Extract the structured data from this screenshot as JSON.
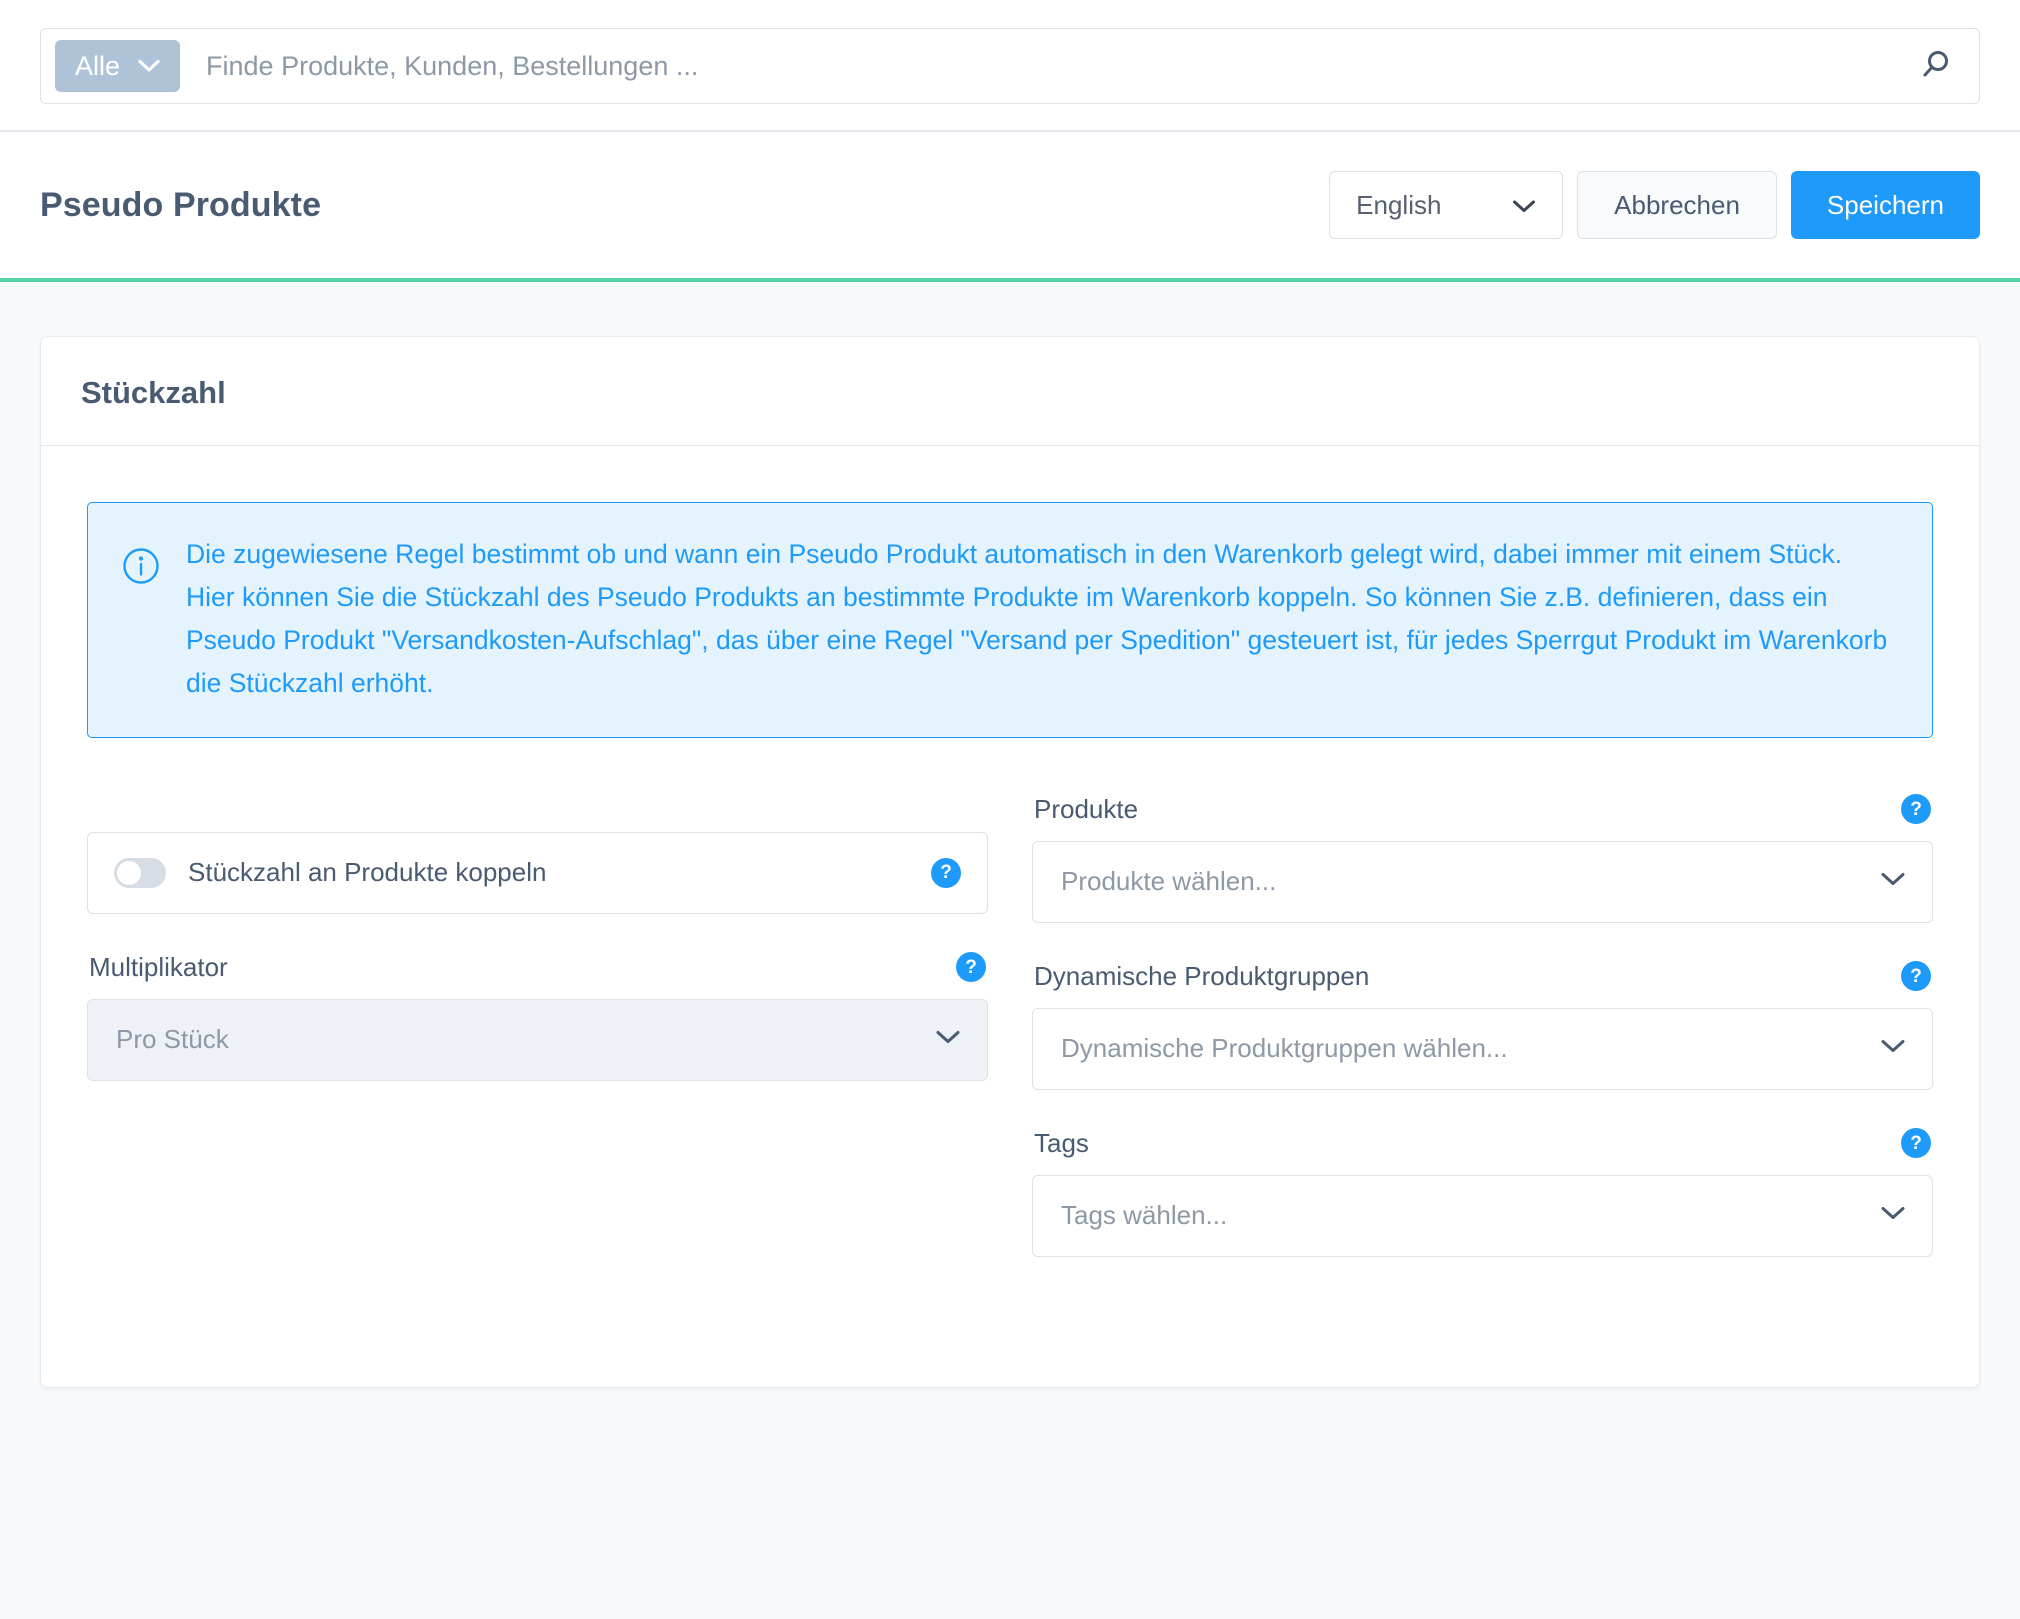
{
  "search": {
    "scope_label": "Alle",
    "placeholder": "Finde Produkte, Kunden, Bestellungen ...",
    "value": "",
    "icon": "search-icon"
  },
  "header": {
    "title": "Pseudo Produkte",
    "language_value": "English",
    "cancel_label": "Abbrechen",
    "save_label": "Speichern",
    "accent_color": "#51d3a5",
    "primary_color": "#1e9bfa"
  },
  "card": {
    "title": "Stückzahl",
    "alert": {
      "icon": "info-circle-icon",
      "text": "Die zugewiesene Regel bestimmt ob und wann ein Pseudo Produkt automatisch in den Warenkorb gelegt wird, dabei immer mit einem Stück. Hier können Sie die Stückzahl des Pseudo Produkts an bestimmte Produkte im Warenkorb koppeln. So können Sie z.B. definieren, dass ein Pseudo Produkt \"Versandkosten-Aufschlag\", das über eine Regel \"Versand per Spedition\" gesteuert ist, für jedes Sperrgut Produkt im Warenkorb die Stückzahl erhöht.",
      "border_color": "#1e9bfa",
      "background_color": "#e4f3fe"
    },
    "coupling_toggle": {
      "label": "Stückzahl an Produkte koppeln",
      "state": "off",
      "help_icon": "help-circle-icon"
    },
    "multiplikator": {
      "label": "Multiplikator",
      "value": "Pro Stück",
      "disabled": true,
      "help_icon": "help-circle-icon",
      "chevron": "chevron-down-icon"
    },
    "produkte": {
      "label": "Produkte",
      "placeholder": "Produkte wählen...",
      "value": "",
      "help_icon": "help-circle-icon",
      "chevron": "chevron-down-icon"
    },
    "dynamische_produktgruppen": {
      "label": "Dynamische Produktgruppen",
      "placeholder": "Dynamische Produktgruppen wählen...",
      "value": "",
      "help_icon": "help-circle-icon",
      "chevron": "chevron-down-icon"
    },
    "tags": {
      "label": "Tags",
      "placeholder": "Tags wählen...",
      "value": "",
      "help_icon": "help-circle-icon",
      "chevron": "chevron-down-icon"
    }
  }
}
